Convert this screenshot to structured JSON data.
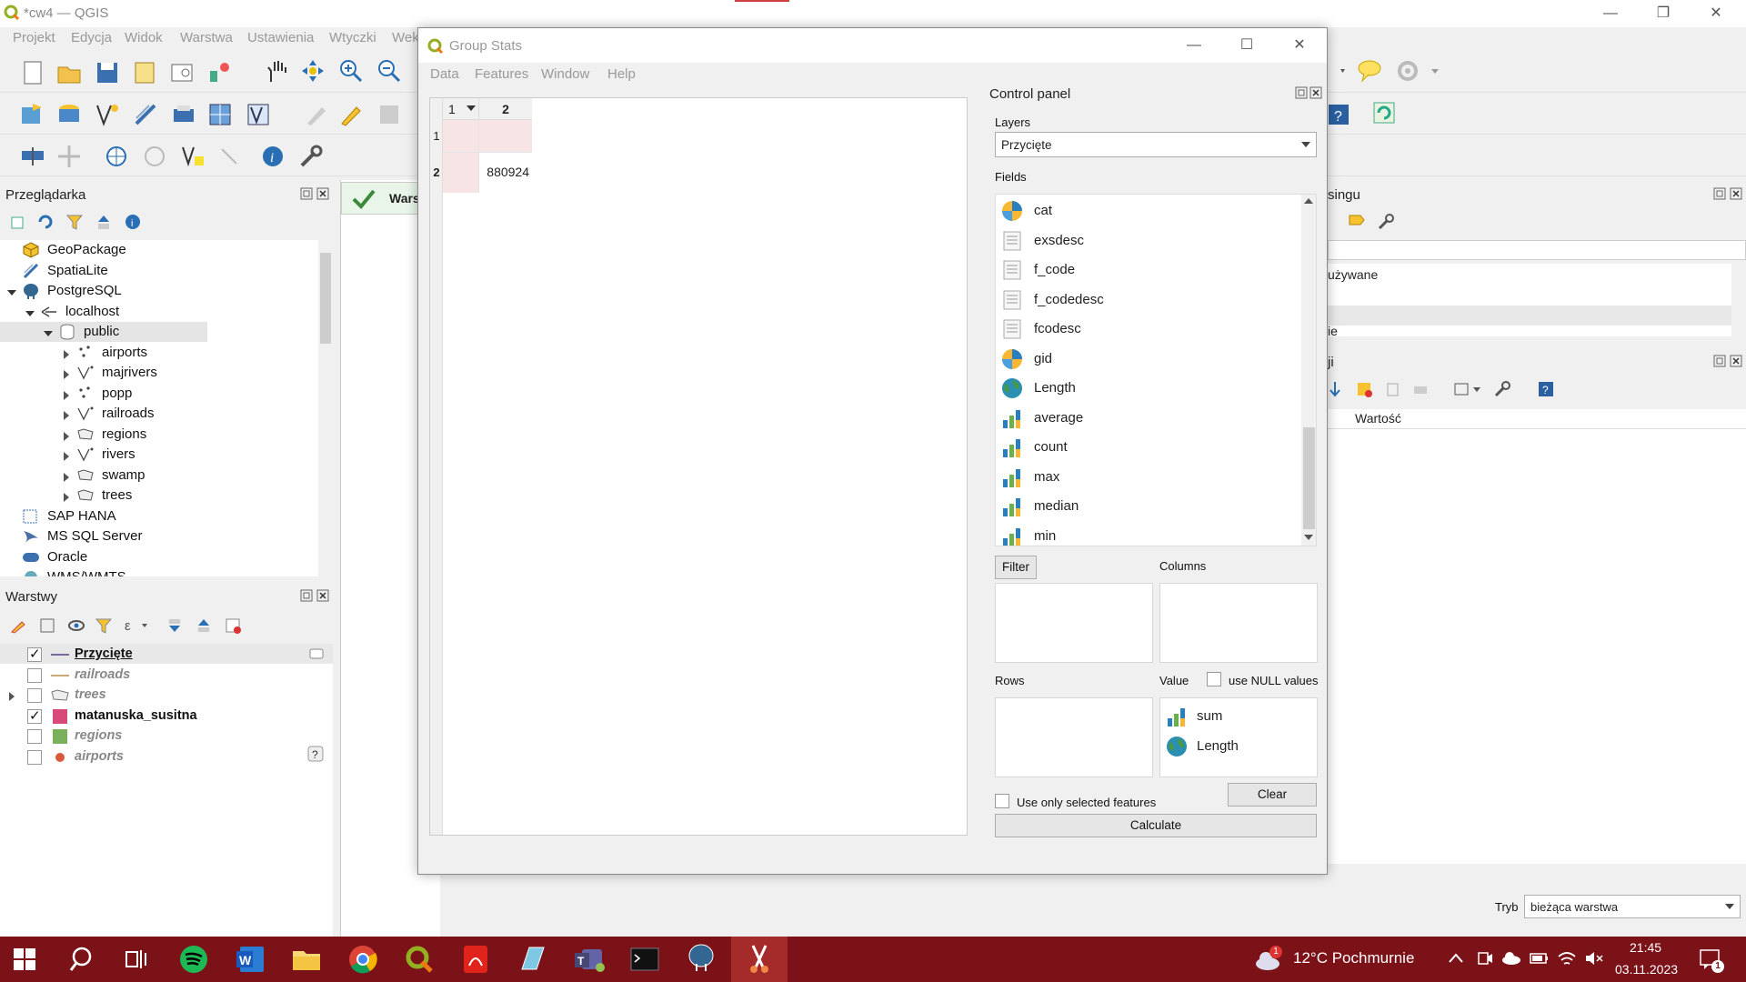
{
  "window": {
    "title": "*cw4 — QGIS"
  },
  "menu": [
    "Projekt",
    "Edycja",
    "Widok",
    "Warstwa",
    "Ustawienia",
    "Wtyczki",
    "Wek"
  ],
  "browser": {
    "title": "Przeglądarka",
    "items": [
      {
        "label": "GeoPackage",
        "icon": "geopackage-icon"
      },
      {
        "label": "SpatiaLite",
        "icon": "spatialite-icon"
      },
      {
        "label": "PostgreSQL",
        "icon": "postgresql-icon"
      },
      {
        "label": "localhost",
        "icon": "connection-icon"
      },
      {
        "label": "public",
        "icon": "schema-icon"
      },
      {
        "label": "airports",
        "icon": "point-layer-icon"
      },
      {
        "label": "majrivers",
        "icon": "line-layer-icon"
      },
      {
        "label": "popp",
        "icon": "point-layer-icon"
      },
      {
        "label": "railroads",
        "icon": "line-layer-icon"
      },
      {
        "label": "regions",
        "icon": "polygon-layer-icon"
      },
      {
        "label": "rivers",
        "icon": "line-layer-icon"
      },
      {
        "label": "swamp",
        "icon": "polygon-layer-icon"
      },
      {
        "label": "trees",
        "icon": "polygon-layer-icon"
      },
      {
        "label": "SAP HANA",
        "icon": "saphana-icon"
      },
      {
        "label": "MS SQL Server",
        "icon": "mssql-icon"
      },
      {
        "label": "Oracle",
        "icon": "oracle-icon"
      },
      {
        "label": "WMS/WMTS",
        "icon": "wms-icon"
      }
    ]
  },
  "layers": {
    "title": "Warstwy",
    "items": [
      {
        "label": "Przycięte",
        "checked": true,
        "style": "bold-underline"
      },
      {
        "label": "railroads",
        "checked": false,
        "style": "italic"
      },
      {
        "label": "trees",
        "checked": false,
        "style": "italic"
      },
      {
        "label": "matanuska_susitna",
        "checked": true,
        "style": "bold"
      },
      {
        "label": "regions",
        "checked": false,
        "style": "italic"
      },
      {
        "label": "airports",
        "checked": false,
        "style": "italic"
      }
    ]
  },
  "centre_tab": {
    "label": "Wars"
  },
  "right_panel": {
    "title_fragment": "singu",
    "row1": "używane",
    "row2": "ie",
    "title2_fragment": "ji",
    "value_header": "Wartość",
    "mode_label": "Tryb",
    "mode_value": "bieżąca warstwa"
  },
  "dialog": {
    "title": "Group Stats",
    "menu": [
      "Data",
      "Features",
      "Window",
      "Help"
    ],
    "table": {
      "col_headers": [
        "1",
        "2"
      ],
      "row_headers": [
        "1",
        "2"
      ],
      "cells": [
        [
          "",
          ""
        ],
        [
          "",
          "880924"
        ]
      ]
    },
    "control_panel": {
      "title": "Control panel",
      "layers_label": "Layers",
      "layer_selected": "Przycięte",
      "fields_label": "Fields",
      "fields": [
        {
          "name": "cat",
          "icon": "pie-icon"
        },
        {
          "name": "exsdesc",
          "icon": "text-icon"
        },
        {
          "name": "f_code",
          "icon": "text-icon"
        },
        {
          "name": "f_codedesc",
          "icon": "text-icon"
        },
        {
          "name": "fcodesc",
          "icon": "text-icon"
        },
        {
          "name": "gid",
          "icon": "pie-icon"
        },
        {
          "name": "Length",
          "icon": "globe-icon"
        },
        {
          "name": "average",
          "icon": "bar-chart-icon"
        },
        {
          "name": "count",
          "icon": "bar-chart-icon"
        },
        {
          "name": "max",
          "icon": "bar-chart-icon"
        },
        {
          "name": "median",
          "icon": "bar-chart-icon"
        },
        {
          "name": "min",
          "icon": "bar-chart-icon"
        }
      ],
      "filter_label": "Filter",
      "columns_label": "Columns",
      "rows_label": "Rows",
      "value_label": "Value",
      "null_label": "use NULL values",
      "value_items": [
        {
          "name": "sum",
          "icon": "bar-chart-icon"
        },
        {
          "name": "Length",
          "icon": "globe-icon"
        }
      ],
      "selected_only_label": "Use only selected features",
      "clear_label": "Clear",
      "calculate_label": "Calculate"
    }
  },
  "taskbar": {
    "weather": "12°C  Pochmurnie",
    "weather_badge": "1",
    "time": "21:45",
    "date": "03.11.2023",
    "notification_count": "1"
  }
}
